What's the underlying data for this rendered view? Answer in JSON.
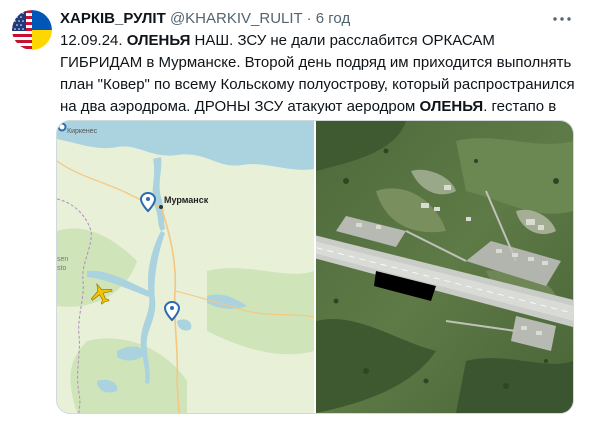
{
  "author": {
    "name": "ХАРКІВ_РУЛІТ",
    "handle": "@KHARKIV_RULIT",
    "separator": "·",
    "time": "6 год"
  },
  "avatar_icon": "usa-ukraine-flag-avatar",
  "tweet": {
    "segments": [
      {
        "text": "12.09.24. ",
        "bold": false
      },
      {
        "text": "ОЛЕНЬЯ",
        "bold": true
      },
      {
        "text": " НАШ.  ЗСУ не дали расслабится ОРКАСАМ ГИБРИДАМ в Мурманске. Второй день подряд им приходится выполнять план \"Ковер\" по всему Кольскому полуострову, который распространился на два аэродрома. ДРОНЫ ЗСУ атакуют аеродром ",
        "bold": false
      },
      {
        "text": "ОЛЕНЬЯ",
        "bold": true
      },
      {
        "text": ". гестапо в шоке.",
        "bold": false
      }
    ]
  },
  "media": {
    "map": {
      "labels": {
        "kirkenes": "Киркенес",
        "murmansk": "Мурманск",
        "partial_1": "sen",
        "partial_2": "sto"
      }
    },
    "satellite": {}
  },
  "colors": {
    "map_land": "#e8f0d8",
    "map_water": "#aad3df",
    "forest": "#c7dfb0",
    "pin": "#2b6cb0",
    "plane": "#f2c300",
    "muted_text": "#536471"
  }
}
